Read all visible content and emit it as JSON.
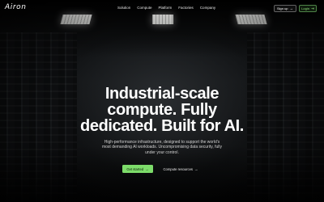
{
  "brand": {
    "logo_text": "Airon"
  },
  "nav": {
    "links": [
      "Solution",
      "Compute",
      "Platform",
      "Factories",
      "Company"
    ],
    "signup_label": "Sign up",
    "login_label": "Login"
  },
  "hero": {
    "headline_lines": [
      "Industrial-scale",
      "compute. Fully",
      "dedicated. Built for AI."
    ],
    "subtext_lines": [
      "High-performance infrastructure, designed to support the world's",
      "most demanding AI workloads. Uncompromising data security, fully",
      "under your control."
    ],
    "primary_cta": "Get started",
    "secondary_cta": "Compute resources",
    "arrow": "→"
  },
  "colors": {
    "accent": "#7ddc6a",
    "background": "#050607"
  }
}
